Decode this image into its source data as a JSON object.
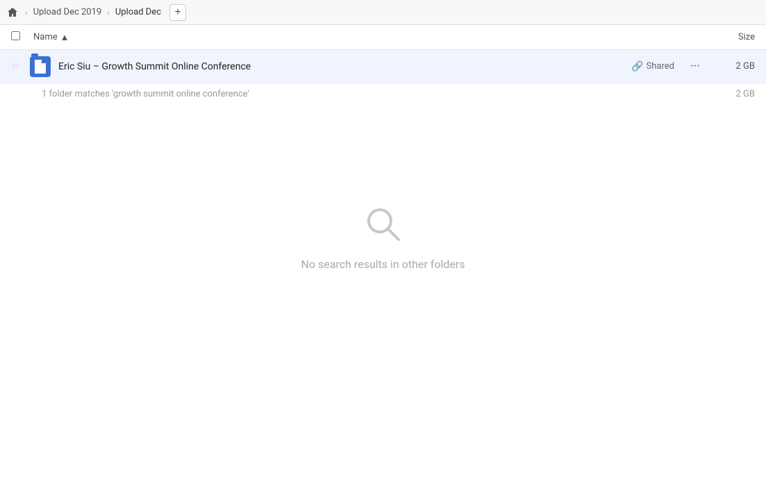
{
  "breadcrumb": {
    "home_label": "home",
    "items": [
      {
        "label": "Upload Dec 2019",
        "active": false
      },
      {
        "label": "Upload Dec",
        "active": true
      }
    ],
    "add_tab_label": "+"
  },
  "columns": {
    "name_label": "Name",
    "sort_indicator": "▲",
    "size_label": "Size"
  },
  "file_row": {
    "name": "Eric Siu – Growth Summit Online Conference",
    "shared_label": "Shared",
    "size": "2 GB",
    "more_icon": "···"
  },
  "match_info": {
    "text": "1 folder matches 'growth summit online conference'",
    "size": "2 GB"
  },
  "empty_state": {
    "message": "No search results in other folders"
  },
  "icons": {
    "home": "⌂",
    "chevron": "›",
    "star": "☆",
    "link": "🔗",
    "more": "···"
  }
}
